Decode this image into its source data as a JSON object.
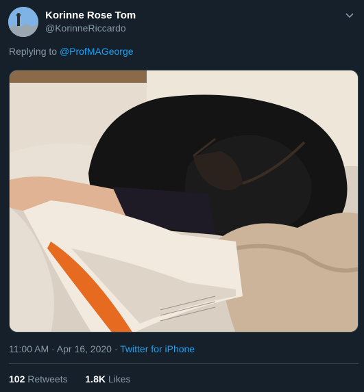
{
  "tweet": {
    "author_name": "Korinne Rose Tom",
    "author_handle": "@KorinneRiccardo",
    "replying_prefix": "Replying to",
    "replying_to": "@ProfMAGeorge",
    "timestamp": "11:00 AM · Apr 16, 2020 · ",
    "source": "Twitter for iPhone",
    "retweets_count": "102",
    "retweets_label": "Retweets",
    "likes_count": "1.8K",
    "likes_label": "Likes"
  },
  "icons": {
    "menu": "chevron-down-icon",
    "avatar": "avatar-image"
  },
  "colors": {
    "background": "#15202b",
    "link": "#1da1f2",
    "muted": "#8899a6",
    "divider": "#38444d"
  }
}
